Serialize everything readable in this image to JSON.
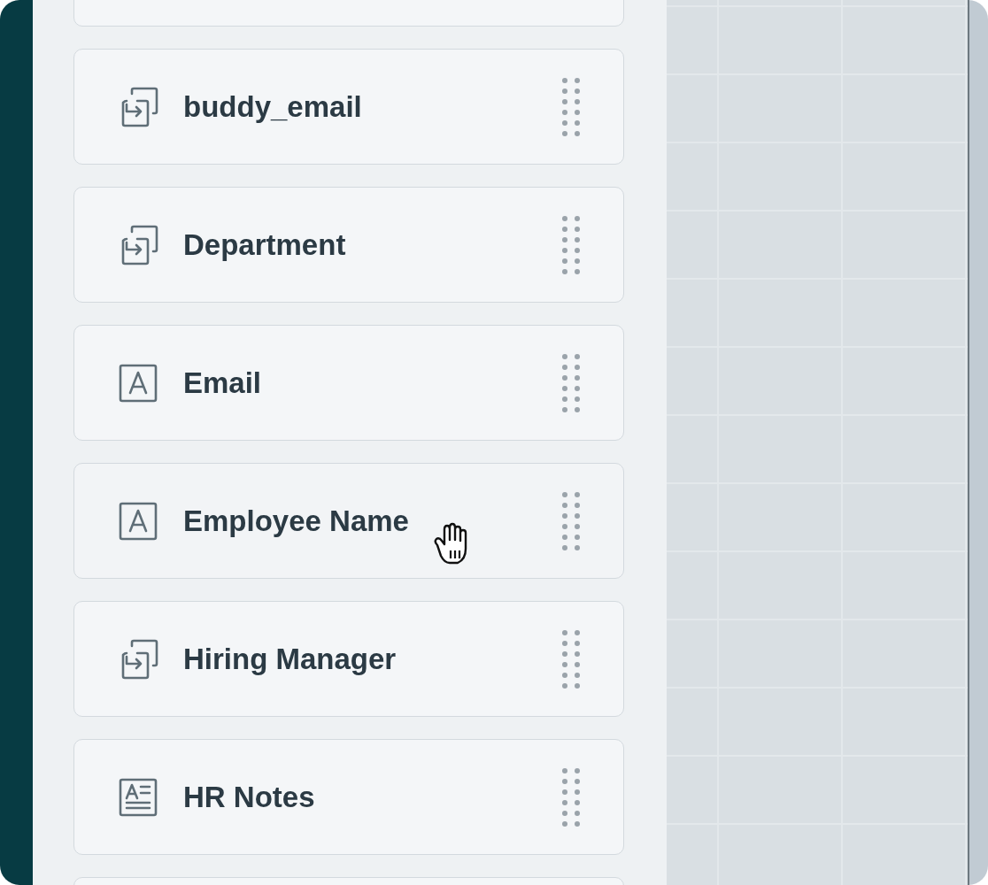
{
  "fields": [
    {
      "label": "buddy_email",
      "kind": "lookup",
      "hovered": false
    },
    {
      "label": "Department",
      "kind": "lookup",
      "hovered": false
    },
    {
      "label": "Email",
      "kind": "text",
      "hovered": false
    },
    {
      "label": "Employee Name",
      "kind": "text",
      "hovered": true
    },
    {
      "label": "Hiring Manager",
      "kind": "lookup",
      "hovered": false
    },
    {
      "label": "HR Notes",
      "kind": "textarea",
      "hovered": false
    }
  ]
}
